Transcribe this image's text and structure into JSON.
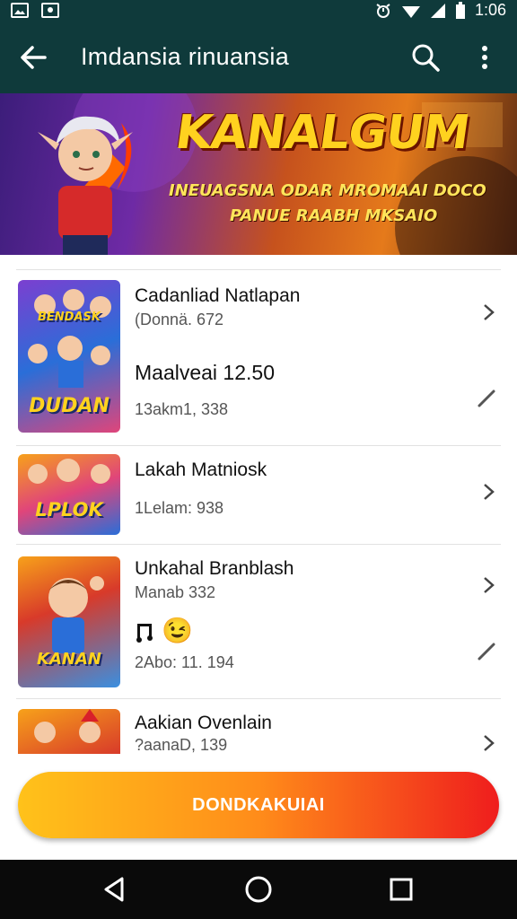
{
  "status_bar": {
    "time": "1:06",
    "icons": [
      "gallery-icon",
      "photo-icon",
      "alarm-icon",
      "wifi-icon",
      "signal-icon",
      "battery-icon"
    ]
  },
  "app_bar": {
    "title": "Imdansia rinuansia",
    "icons": [
      "back-arrow-icon",
      "search-icon",
      "more-vert-icon"
    ]
  },
  "banner": {
    "headline": "KANALGUM",
    "line1": "INEUAGSNA ODAR MROMAAI DOCO",
    "line2": "PANUE RAABH MKSAIO"
  },
  "items": [
    {
      "title": "Cadanliad Natlapan",
      "subtitle": "(Donnä. 672",
      "title2": "Maalveai 12.50",
      "subtitle2": "13akm1, 338",
      "thumb_top": "BENDASK",
      "thumb_caption": "DUDAN"
    },
    {
      "title": "Lakah Matniosk",
      "subtitle": "1Lelam: 938",
      "thumb_caption": "LPLOK"
    },
    {
      "title": "Unkahal Branblash",
      "subtitle": "Manab 332",
      "emoji": "😉",
      "subtitle2": "2Abo: 11. 194",
      "thumb_caption": "KANAN"
    },
    {
      "title": "Aakian Ovenlain",
      "subtitle": "?aanaD, 139"
    }
  ],
  "cta_label": "DONDKAKUIAI",
  "nav_bar": {
    "icons": [
      "back-triangle-icon",
      "home-circle-icon",
      "recents-square-icon"
    ]
  },
  "colors": {
    "app_bar": "#0f3a3b",
    "cta_start": "#ffc21a",
    "cta_end": "#ef1d1d",
    "nav_bar": "#0a0a0a"
  }
}
